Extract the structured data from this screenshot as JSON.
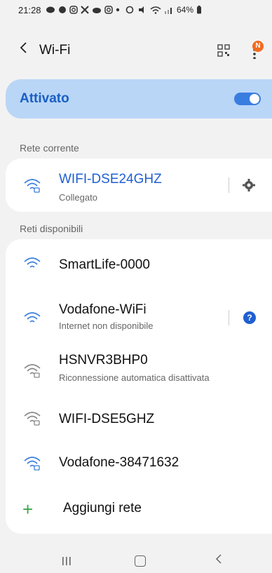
{
  "status_bar": {
    "time": "21:28",
    "battery": "64%"
  },
  "app_bar": {
    "title": "Wi-Fi",
    "notification_badge": "N"
  },
  "wifi_toggle": {
    "label": "Attivato",
    "state": "on"
  },
  "current_section": {
    "heading": "Rete corrente",
    "network": {
      "name": "WIFI-DSE24GHZ",
      "status": "Collegato"
    }
  },
  "available_section": {
    "heading": "Reti disponibili",
    "networks": [
      {
        "name": "SmartLife-0000",
        "subtitle": ""
      },
      {
        "name": "Vodafone-WiFi",
        "subtitle": "Internet non disponibile"
      },
      {
        "name": "HSNVR3BHP0",
        "subtitle": "Riconnessione automatica disattivata"
      },
      {
        "name": "WIFI-DSE5GHZ",
        "subtitle": ""
      },
      {
        "name": "Vodafone-38471632",
        "subtitle": ""
      }
    ],
    "add_network_label": "Aggiungi rete"
  },
  "colors": {
    "accent": "#3a7de0",
    "toggle_card": "#b9d6f7",
    "connected_text": "#1f5fd1",
    "add_icon": "#3da84b",
    "badge": "#f26b21"
  }
}
